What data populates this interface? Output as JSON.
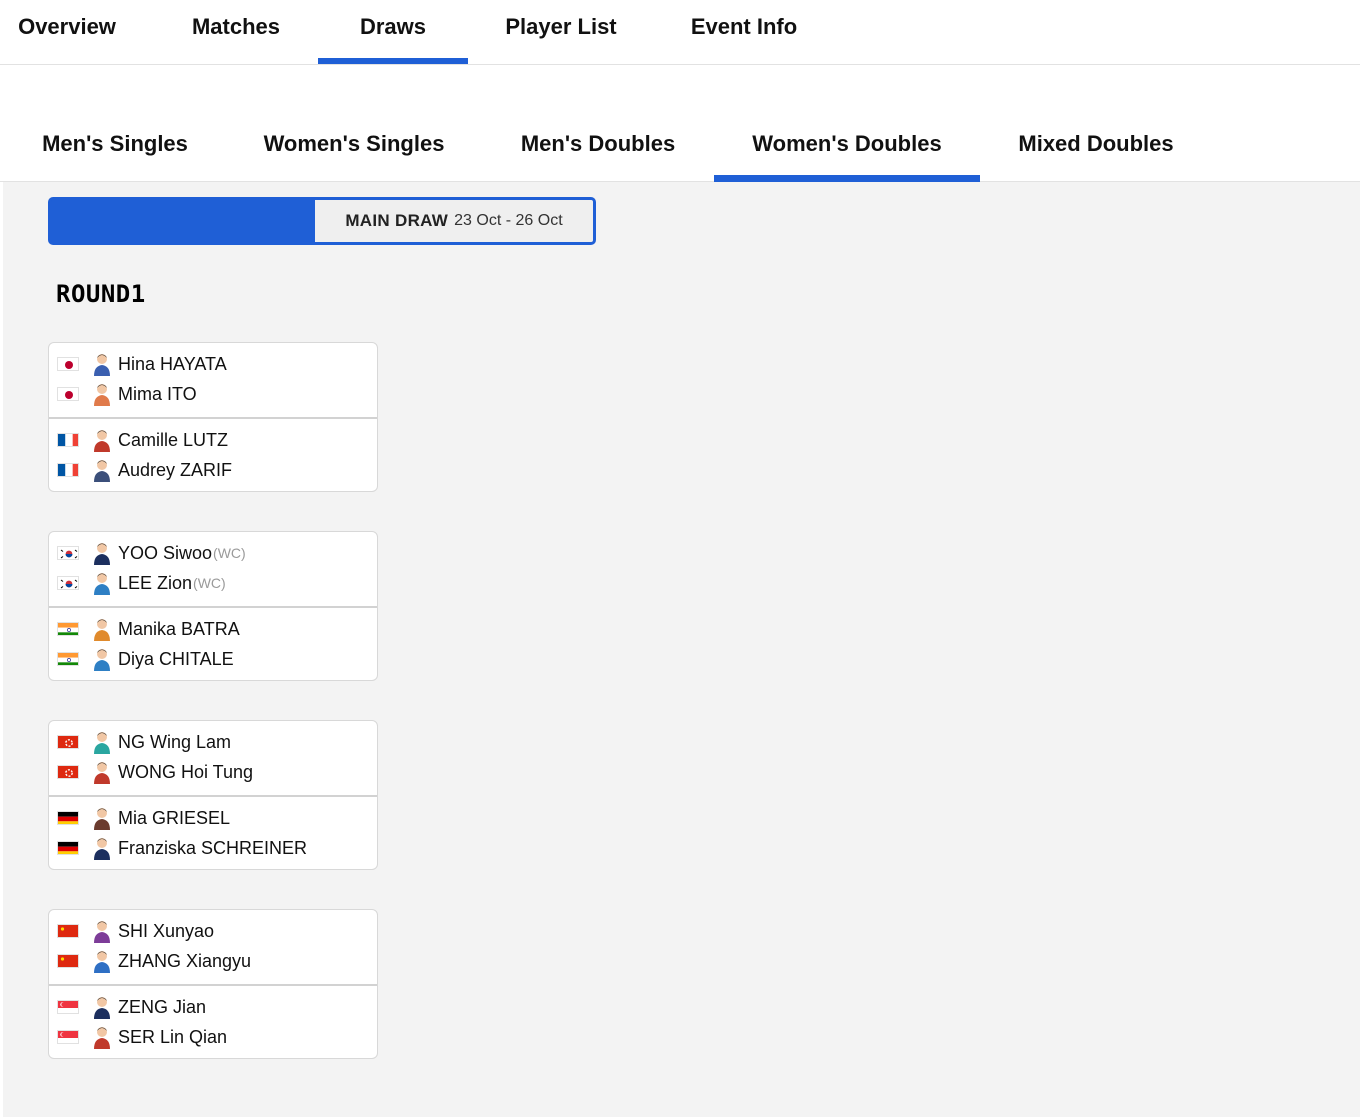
{
  "top_tabs": [
    {
      "label": "Overview",
      "active": false
    },
    {
      "label": "Matches",
      "active": false
    },
    {
      "label": "Draws",
      "active": true
    },
    {
      "label": "Player List",
      "active": false
    },
    {
      "label": "Event Info",
      "active": false
    }
  ],
  "event_tabs": [
    {
      "label": "Men's Singles",
      "active": false
    },
    {
      "label": "Women's Singles",
      "active": false
    },
    {
      "label": "Men's Doubles",
      "active": false
    },
    {
      "label": "Women's Doubles",
      "active": true
    },
    {
      "label": "Mixed Doubles",
      "active": false
    }
  ],
  "draw_toggle": {
    "label": "MAIN DRAW",
    "dates": "23 Oct - 26 Oct"
  },
  "round_title": "ROUND1",
  "colors": {
    "accent": "#1f5fd6",
    "panel_bg": "#f3f3f3"
  },
  "matches": [
    {
      "teams": [
        {
          "players": [
            {
              "name": "Hina HAYATA",
              "country": "JPN",
              "tag": "",
              "avatar_color": "#3a5fb0"
            },
            {
              "name": "Mima ITO",
              "country": "JPN",
              "tag": "",
              "avatar_color": "#e07a4a"
            }
          ]
        },
        {
          "players": [
            {
              "name": "Camille LUTZ",
              "country": "FRA",
              "tag": "",
              "avatar_color": "#c0392b"
            },
            {
              "name": "Audrey ZARIF",
              "country": "FRA",
              "tag": "",
              "avatar_color": "#3b4f7a"
            }
          ]
        }
      ]
    },
    {
      "teams": [
        {
          "players": [
            {
              "name": "YOO Siwoo",
              "country": "KOR",
              "tag": "(WC)",
              "avatar_color": "#1c2f5e"
            },
            {
              "name": "LEE Zion",
              "country": "KOR",
              "tag": "(WC)",
              "avatar_color": "#2e7fc4"
            }
          ]
        },
        {
          "players": [
            {
              "name": "Manika BATRA",
              "country": "IND",
              "tag": "",
              "avatar_color": "#e08a2c"
            },
            {
              "name": "Diya CHITALE",
              "country": "IND",
              "tag": "",
              "avatar_color": "#2e7fc4"
            }
          ]
        }
      ]
    },
    {
      "teams": [
        {
          "players": [
            {
              "name": "NG Wing Lam",
              "country": "HKG",
              "tag": "",
              "avatar_color": "#2aa6a0"
            },
            {
              "name": "WONG Hoi Tung",
              "country": "HKG",
              "tag": "",
              "avatar_color": "#c0392b"
            }
          ]
        },
        {
          "players": [
            {
              "name": "Mia GRIESEL",
              "country": "GER",
              "tag": "",
              "avatar_color": "#6b3b2e"
            },
            {
              "name": "Franziska SCHREINER",
              "country": "GER",
              "tag": "",
              "avatar_color": "#1c2f5e"
            }
          ]
        }
      ]
    },
    {
      "teams": [
        {
          "players": [
            {
              "name": "SHI Xunyao",
              "country": "CHN",
              "tag": "",
              "avatar_color": "#7d3c98"
            },
            {
              "name": "ZHANG Xiangyu",
              "country": "CHN",
              "tag": "",
              "avatar_color": "#2e6fc4"
            }
          ]
        },
        {
          "players": [
            {
              "name": "ZENG Jian",
              "country": "SGP",
              "tag": "",
              "avatar_color": "#1c2f5e"
            },
            {
              "name": "SER Lin Qian",
              "country": "SGP",
              "tag": "",
              "avatar_color": "#c0392b"
            }
          ]
        }
      ]
    }
  ]
}
